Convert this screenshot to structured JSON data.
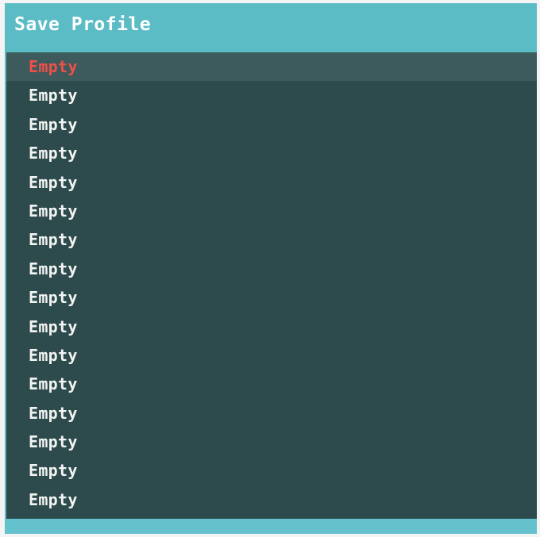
{
  "window": {
    "title": "Save Profile"
  },
  "profile_slots": [
    {
      "label": "Empty",
      "selected": true
    },
    {
      "label": "Empty",
      "selected": false
    },
    {
      "label": "Empty",
      "selected": false
    },
    {
      "label": "Empty",
      "selected": false
    },
    {
      "label": "Empty",
      "selected": false
    },
    {
      "label": "Empty",
      "selected": false
    },
    {
      "label": "Empty",
      "selected": false
    },
    {
      "label": "Empty",
      "selected": false
    },
    {
      "label": "Empty",
      "selected": false
    },
    {
      "label": "Empty",
      "selected": false
    },
    {
      "label": "Empty",
      "selected": false
    },
    {
      "label": "Empty",
      "selected": false
    },
    {
      "label": "Empty",
      "selected": false
    },
    {
      "label": "Empty",
      "selected": false
    },
    {
      "label": "Empty",
      "selected": false
    },
    {
      "label": "Empty",
      "selected": false
    }
  ],
  "colors": {
    "frame_background": "#5cbcc6",
    "list_background": "#2d4a4c",
    "selected_row_background": "#3d5a5c",
    "selected_text": "#f05048",
    "normal_text": "#f2f4f2",
    "title_text": "#ffffff"
  }
}
